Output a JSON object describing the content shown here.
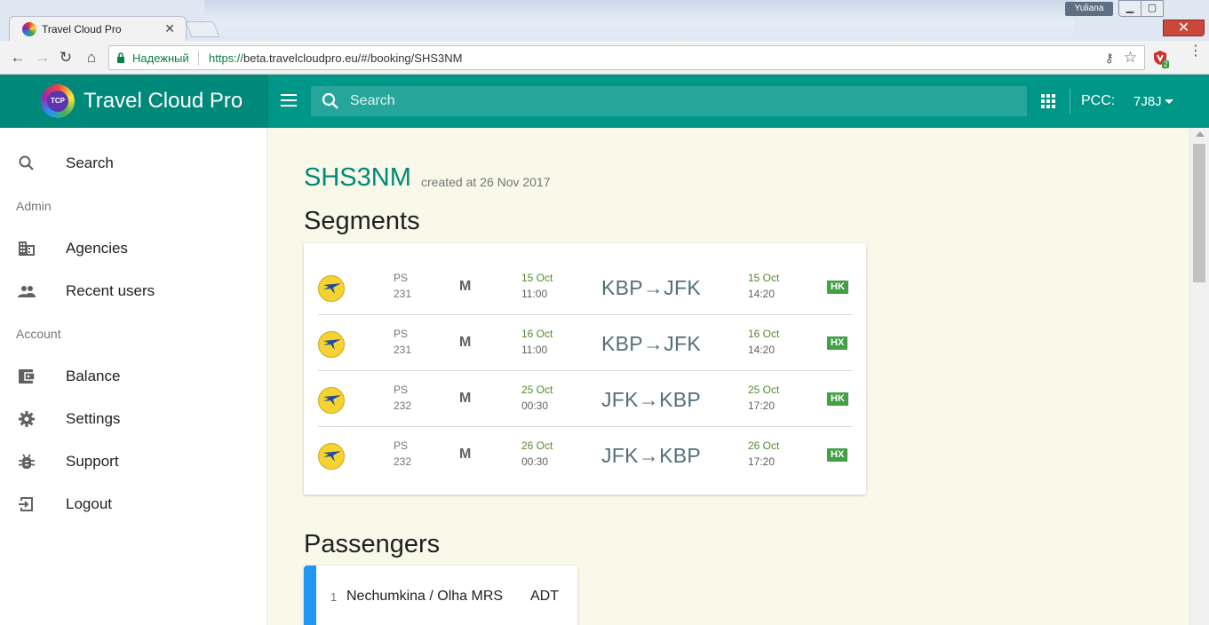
{
  "browser": {
    "tab_title": "Travel Cloud Pro",
    "tab_close": "✕",
    "user_name": "Yuliana",
    "secure_label": "Надежный",
    "url_protocol": "https://",
    "url_rest": "beta.travelcloudpro.eu/#/booking/SHS3NM",
    "extension_badge": "2"
  },
  "header": {
    "brand": "Travel Cloud Pro",
    "logo_text": "TCP",
    "search_placeholder": "Search",
    "pcc_label": "PCC:",
    "pcc_value": "7J8J"
  },
  "sidebar": {
    "search": "Search",
    "admin_section": "Admin",
    "agencies": "Agencies",
    "recent_users": "Recent users",
    "account_section": "Account",
    "balance": "Balance",
    "settings": "Settings",
    "support": "Support",
    "logout": "Logout"
  },
  "booking": {
    "pnr": "SHS3NM",
    "created": "created at 26 Nov 2017",
    "segments_heading": "Segments",
    "segments": [
      {
        "airline": "PS",
        "flight": "231",
        "class": "M",
        "dep_date": "15 Oct",
        "dep_time": "11:00",
        "route": "KBP→JFK",
        "arr_date": "15 Oct",
        "arr_time": "14:20",
        "status": "HK"
      },
      {
        "airline": "PS",
        "flight": "231",
        "class": "M",
        "dep_date": "16 Oct",
        "dep_time": "11:00",
        "route": "KBP→JFK",
        "arr_date": "16 Oct",
        "arr_time": "14:20",
        "status": "HX"
      },
      {
        "airline": "PS",
        "flight": "232",
        "class": "M",
        "dep_date": "25 Oct",
        "dep_time": "00:30",
        "route": "JFK→KBP",
        "arr_date": "25 Oct",
        "arr_time": "17:20",
        "status": "HK"
      },
      {
        "airline": "PS",
        "flight": "232",
        "class": "M",
        "dep_date": "26 Oct",
        "dep_time": "00:30",
        "route": "JFK→KBP",
        "arr_date": "26 Oct",
        "arr_time": "17:20",
        "status": "HX"
      }
    ],
    "passengers_heading": "Passengers",
    "passengers": [
      {
        "num": "1",
        "name": "Nechumkina / Olha MRS",
        "type": "ADT"
      }
    ]
  },
  "colors": {
    "primary": "#009688",
    "primary_dark": "#00897b",
    "status_green": "#43a047",
    "airline_yellow": "#f7d332",
    "passenger_accent": "#2196f3"
  }
}
